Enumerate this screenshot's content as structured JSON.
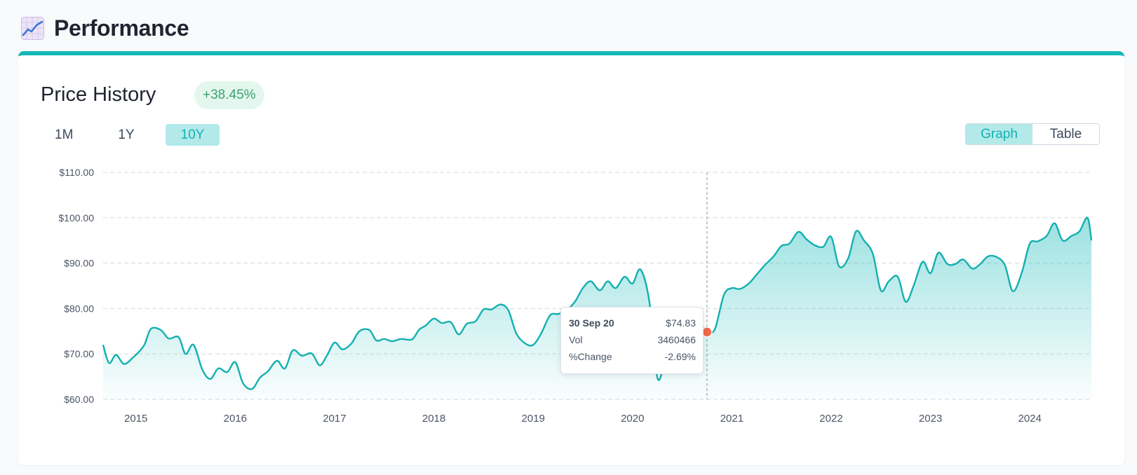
{
  "header": {
    "title": "Performance",
    "icon": "chart-line-icon"
  },
  "card": {
    "title": "Price History",
    "change_badge": "+38.45%",
    "range_tabs": [
      {
        "label": "1M",
        "active": false
      },
      {
        "label": "1Y",
        "active": false
      },
      {
        "label": "10Y",
        "active": true
      }
    ],
    "view_toggle": [
      {
        "label": "Graph",
        "active": true
      },
      {
        "label": "Table",
        "active": false
      }
    ]
  },
  "tooltip": {
    "date": "30 Sep 20",
    "price": "$74.83",
    "vol_label": "Vol",
    "vol_value": "3460466",
    "change_label": "%Change",
    "change_value": "-2.69%"
  },
  "colors": {
    "accent": "#14b8b8",
    "line": "#14b0b0",
    "marker": "#f26a4b",
    "badge_text": "#3aa36e"
  },
  "chart_data": {
    "type": "area",
    "ylim": [
      60,
      110
    ],
    "yticks": [
      110,
      100,
      90,
      80,
      70,
      60
    ],
    "ytick_labels": [
      "$110.00",
      "$100.00",
      "$90.00",
      "$80.00",
      "$70.00",
      "$60.00"
    ],
    "xlim": [
      2014.67,
      2024.62
    ],
    "xticks": [
      2015,
      2016,
      2017,
      2018,
      2019,
      2020,
      2021,
      2022,
      2023,
      2024
    ],
    "xtick_labels": [
      "2015",
      "2016",
      "2017",
      "2018",
      "2019",
      "2020",
      "2021",
      "2022",
      "2023",
      "2024"
    ],
    "grid": true,
    "hover": {
      "x": 2020.75,
      "y": 74.83
    },
    "series": [
      {
        "points": [
          [
            2014.67,
            72.0
          ],
          [
            2014.73,
            68.0
          ],
          [
            2014.8,
            69.8
          ],
          [
            2014.88,
            67.8
          ],
          [
            2014.97,
            69.2
          ],
          [
            2015.08,
            71.8
          ],
          [
            2015.15,
            75.5
          ],
          [
            2015.25,
            75.3
          ],
          [
            2015.33,
            73.4
          ],
          [
            2015.43,
            73.7
          ],
          [
            2015.5,
            70.0
          ],
          [
            2015.58,
            72.0
          ],
          [
            2015.67,
            66.5
          ],
          [
            2015.75,
            64.5
          ],
          [
            2015.83,
            66.8
          ],
          [
            2015.92,
            66.0
          ],
          [
            2016.0,
            68.2
          ],
          [
            2016.08,
            63.5
          ],
          [
            2016.17,
            62.3
          ],
          [
            2016.25,
            64.8
          ],
          [
            2016.33,
            66.2
          ],
          [
            2016.42,
            68.5
          ],
          [
            2016.5,
            66.8
          ],
          [
            2016.58,
            70.8
          ],
          [
            2016.67,
            69.6
          ],
          [
            2016.77,
            70.1
          ],
          [
            2016.85,
            67.5
          ],
          [
            2016.92,
            69.5
          ],
          [
            2017.0,
            72.5
          ],
          [
            2017.08,
            71.0
          ],
          [
            2017.17,
            72.3
          ],
          [
            2017.25,
            75.0
          ],
          [
            2017.35,
            75.3
          ],
          [
            2017.42,
            73.0
          ],
          [
            2017.5,
            73.3
          ],
          [
            2017.58,
            72.8
          ],
          [
            2017.67,
            73.3
          ],
          [
            2017.78,
            73.2
          ],
          [
            2017.85,
            75.3
          ],
          [
            2017.92,
            76.3
          ],
          [
            2018.0,
            77.8
          ],
          [
            2018.08,
            76.8
          ],
          [
            2018.17,
            77.0
          ],
          [
            2018.25,
            74.3
          ],
          [
            2018.33,
            76.6
          ],
          [
            2018.42,
            77.2
          ],
          [
            2018.5,
            79.8
          ],
          [
            2018.58,
            79.8
          ],
          [
            2018.67,
            80.9
          ],
          [
            2018.75,
            79.6
          ],
          [
            2018.83,
            74.5
          ],
          [
            2018.92,
            72.3
          ],
          [
            2019.0,
            72.0
          ],
          [
            2019.08,
            74.5
          ],
          [
            2019.17,
            78.5
          ],
          [
            2019.25,
            78.8
          ],
          [
            2019.33,
            79.5
          ],
          [
            2019.42,
            81.5
          ],
          [
            2019.5,
            84.5
          ],
          [
            2019.58,
            86.0
          ],
          [
            2019.67,
            84.0
          ],
          [
            2019.75,
            86.0
          ],
          [
            2019.83,
            84.5
          ],
          [
            2019.92,
            87.0
          ],
          [
            2020.0,
            85.5
          ],
          [
            2020.08,
            88.6
          ],
          [
            2020.17,
            81.5
          ],
          [
            2020.25,
            64.8
          ],
          [
            2020.33,
            68.5
          ],
          [
            2020.42,
            72.0
          ],
          [
            2020.5,
            75.5
          ],
          [
            2020.58,
            76.5
          ],
          [
            2020.67,
            76.9
          ],
          [
            2020.75,
            74.83
          ],
          [
            2020.83,
            75.5
          ],
          [
            2020.92,
            83.0
          ],
          [
            2021.0,
            84.5
          ],
          [
            2021.08,
            84.3
          ],
          [
            2021.17,
            85.5
          ],
          [
            2021.25,
            87.5
          ],
          [
            2021.33,
            89.5
          ],
          [
            2021.42,
            91.5
          ],
          [
            2021.5,
            93.8
          ],
          [
            2021.58,
            94.3
          ],
          [
            2021.67,
            96.9
          ],
          [
            2021.75,
            95.3
          ],
          [
            2021.83,
            94.0
          ],
          [
            2021.92,
            93.6
          ],
          [
            2022.0,
            95.8
          ],
          [
            2022.08,
            89.3
          ],
          [
            2022.17,
            91.0
          ],
          [
            2022.25,
            97.0
          ],
          [
            2022.33,
            95.0
          ],
          [
            2022.42,
            92.0
          ],
          [
            2022.5,
            84.0
          ],
          [
            2022.58,
            86.0
          ],
          [
            2022.67,
            87.0
          ],
          [
            2022.75,
            81.5
          ],
          [
            2022.83,
            85.0
          ],
          [
            2022.92,
            90.3
          ],
          [
            2023.0,
            87.8
          ],
          [
            2023.08,
            92.3
          ],
          [
            2023.17,
            89.8
          ],
          [
            2023.25,
            89.8
          ],
          [
            2023.33,
            90.8
          ],
          [
            2023.42,
            88.8
          ],
          [
            2023.5,
            89.8
          ],
          [
            2023.58,
            91.5
          ],
          [
            2023.67,
            91.3
          ],
          [
            2023.75,
            89.5
          ],
          [
            2023.83,
            83.8
          ],
          [
            2023.92,
            88.0
          ],
          [
            2024.0,
            94.3
          ],
          [
            2024.08,
            94.8
          ],
          [
            2024.17,
            96.0
          ],
          [
            2024.25,
            98.8
          ],
          [
            2024.33,
            95.0
          ],
          [
            2024.42,
            96.0
          ],
          [
            2024.5,
            97.0
          ],
          [
            2024.58,
            100.0
          ],
          [
            2024.62,
            95.0
          ]
        ]
      }
    ]
  }
}
